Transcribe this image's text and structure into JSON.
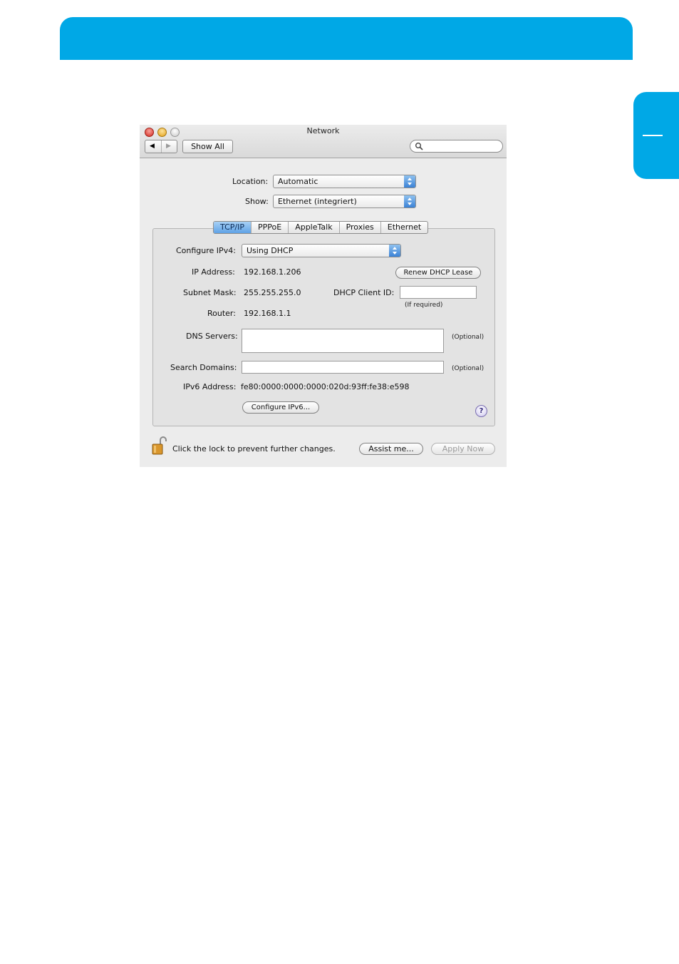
{
  "window": {
    "title": "Network"
  },
  "toolbar": {
    "back_glyph": "◀",
    "forward_glyph": "▶",
    "show_all": "Show All",
    "search_placeholder": "",
    "search_icon": "magnifier-icon"
  },
  "location": {
    "label": "Location:",
    "value": "Automatic"
  },
  "show": {
    "label": "Show:",
    "value": "Ethernet (integriert)"
  },
  "tabs": [
    {
      "label": "TCP/IP",
      "active": true
    },
    {
      "label": "PPPoE",
      "active": false
    },
    {
      "label": "AppleTalk",
      "active": false
    },
    {
      "label": "Proxies",
      "active": false
    },
    {
      "label": "Ethernet",
      "active": false
    }
  ],
  "tcpip": {
    "configure_label": "Configure IPv4:",
    "configure_value": "Using DHCP",
    "ip_label": "IP Address:",
    "ip_value": "192.168.1.206",
    "renew_button": "Renew DHCP Lease",
    "subnet_label": "Subnet Mask:",
    "subnet_value": "255.255.255.0",
    "client_id_label": "DHCP Client ID:",
    "client_id_value": "",
    "client_id_hint": "(If required)",
    "router_label": "Router:",
    "router_value": "192.168.1.1",
    "dns_label": "DNS Servers:",
    "dns_value": "",
    "dns_hint": "(Optional)",
    "search_label": "Search Domains:",
    "search_value": "",
    "search_hint": "(Optional)",
    "ipv6_label": "IPv6 Address:",
    "ipv6_value": "fe80:0000:0000:0000:020d:93ff:fe38:e598",
    "configure_ipv6_button": "Configure IPv6...",
    "help_glyph": "?"
  },
  "footer": {
    "lock_text": "Click the lock to prevent further changes.",
    "assist_button": "Assist me...",
    "apply_button": "Apply Now"
  },
  "colors": {
    "brand_blue": "#00a8e6",
    "active_tab": "#5fa2e6"
  }
}
